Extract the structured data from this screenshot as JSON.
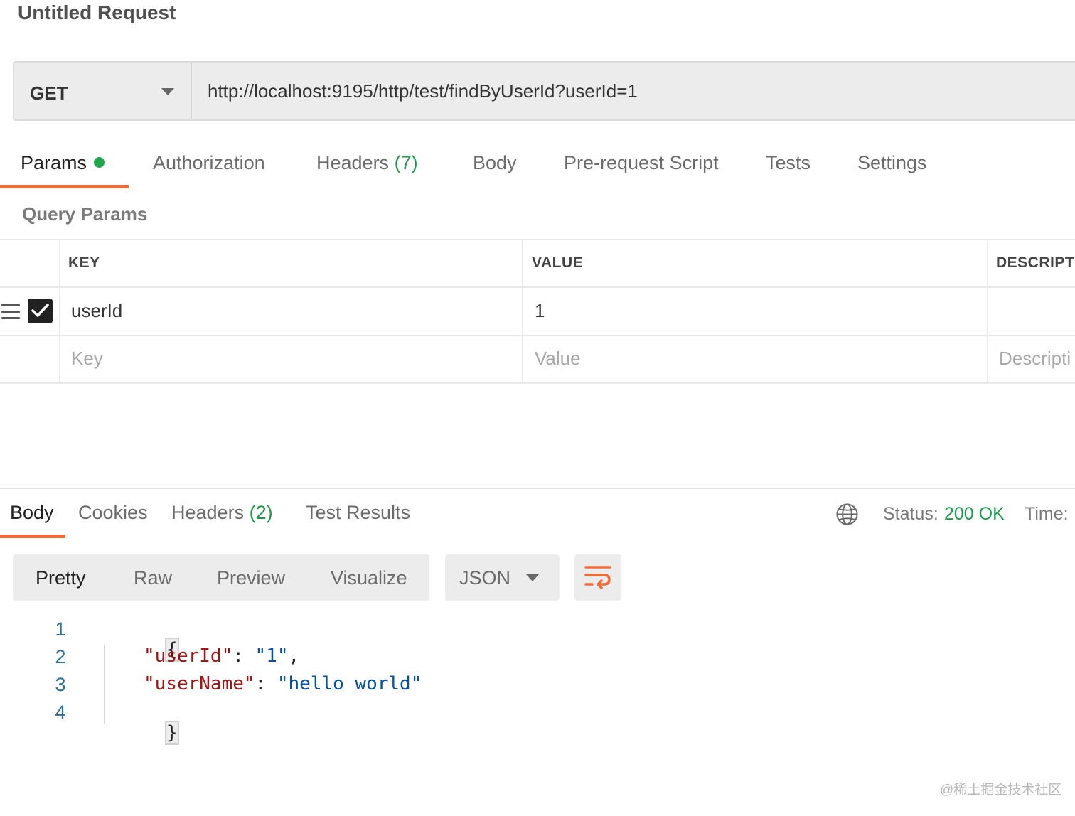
{
  "request": {
    "title": "Untitled Request",
    "method": "GET",
    "url": "http://localhost:9195/http/test/findByUserId?userId=1"
  },
  "request_tabs": {
    "params": "Params",
    "authorization": "Authorization",
    "headers": "Headers",
    "headers_count": "(7)",
    "body": "Body",
    "prerequest": "Pre-request Script",
    "tests": "Tests",
    "settings": "Settings"
  },
  "query_params": {
    "section_label": "Query Params",
    "headers": {
      "key": "KEY",
      "value": "VALUE",
      "description": "DESCRIPTI"
    },
    "rows": [
      {
        "key": "userId",
        "value": "1",
        "description": "",
        "checked": true
      }
    ],
    "placeholders": {
      "key": "Key",
      "value": "Value",
      "description": "Descripti"
    }
  },
  "response": {
    "tabs": {
      "body": "Body",
      "cookies": "Cookies",
      "headers": "Headers",
      "headers_count": "(2)",
      "test_results": "Test Results"
    },
    "status_label": "Status:",
    "status_value": "200 OK",
    "time_label": "Time:",
    "view_modes": [
      "Pretty",
      "Raw",
      "Preview",
      "Visualize"
    ],
    "format": "JSON",
    "line_numbers": [
      "1",
      "2",
      "3",
      "4"
    ],
    "code": {
      "open_brace": "{",
      "key1": "\"userId\"",
      "val1": "\"1\"",
      "key2": "\"userName\"",
      "val2": "\"hello world\"",
      "close_brace": "}"
    }
  },
  "watermark": "@稀土掘金技术社区",
  "colors": {
    "accent": "#ef6c3a",
    "success": "#1e9a4a",
    "json_key": "#a31515",
    "json_string": "#0451a5",
    "line_number": "#2a6f97"
  },
  "icons": [
    "chevron-down-icon",
    "drag-handle-icon",
    "checkbox-checked-icon",
    "globe-icon",
    "wrap-lines-icon"
  ]
}
